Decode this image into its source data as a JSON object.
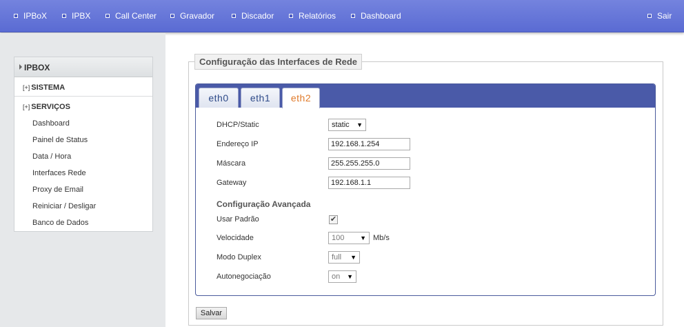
{
  "nav": {
    "items": [
      "IPBoX",
      "IPBX",
      "Call Center",
      "Gravador",
      "Discador",
      "Relatórios",
      "Dashboard"
    ],
    "logout": "Sair"
  },
  "sidebar": {
    "header": "IPBOX",
    "sections": [
      {
        "toggle": "[+]",
        "label": "SISTEMA"
      },
      {
        "toggle": "[+]",
        "label": "SERVIÇOS"
      }
    ],
    "links": [
      "Dashboard",
      "Painel de Status",
      "Data / Hora",
      "Interfaces Rede",
      "Proxy de Email",
      "Reiniciar / Desligar",
      "Banco de Dados"
    ]
  },
  "main": {
    "title": "Configuração das Interfaces de Rede",
    "tabs": [
      "eth0",
      "eth1",
      "eth2"
    ],
    "active_tab": "eth2",
    "fields": {
      "dhcp_label": "DHCP/Static",
      "dhcp_value": "static",
      "ip_label": "Endereço IP",
      "ip_value": "192.168.1.254",
      "mask_label": "Máscara",
      "mask_value": "255.255.255.0",
      "gateway_label": "Gateway",
      "gateway_value": "192.168.1.1"
    },
    "advanced": {
      "title": "Configuração Avançada",
      "default_label": "Usar Padrão",
      "default_checked": true,
      "speed_label": "Velocidade",
      "speed_value": "100",
      "speed_unit": "Mb/s",
      "duplex_label": "Modo Duplex",
      "duplex_value": "full",
      "autoneg_label": "Autonegociação",
      "autoneg_value": "on"
    },
    "save_label": "Salvar"
  },
  "colors": {
    "nav_bg": "#5a6bd3",
    "tabstrip_bg": "#4a5aa8",
    "active_tab_text": "#e07a2a",
    "tab_text": "#2e4a88"
  },
  "icons": {
    "nav_bullet": "square-bullet-icon",
    "sidebar_header": "triangle-right-icon",
    "dropdown": "triangle-down-icon",
    "checkbox": "checkmark-icon"
  }
}
